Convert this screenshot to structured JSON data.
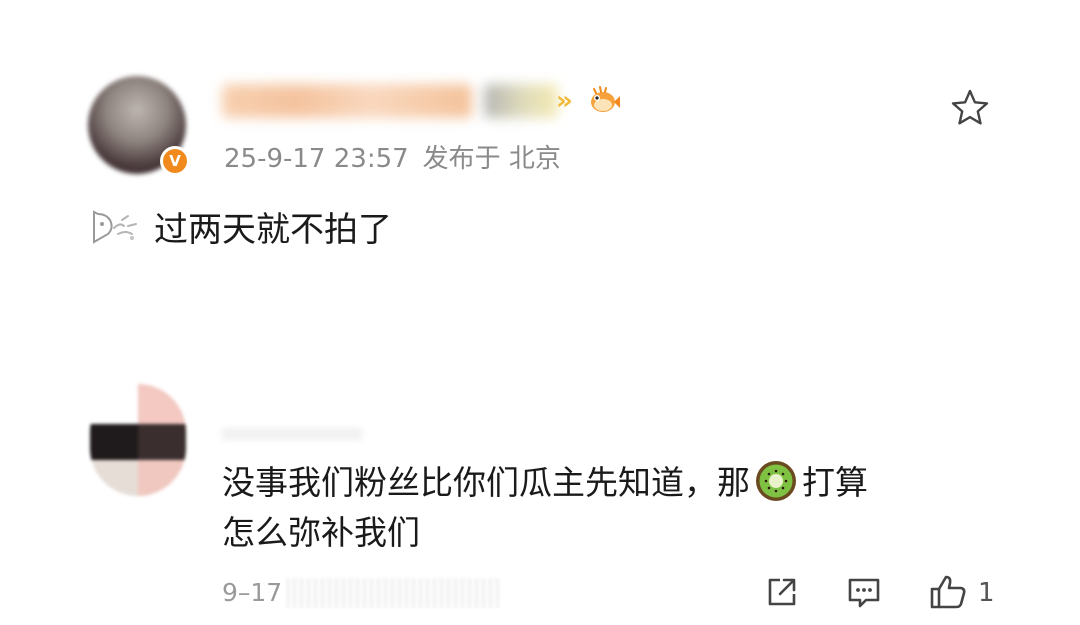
{
  "post": {
    "timestamp": "25-9-17 23:57",
    "location_label": "发布于 北京",
    "text": "过两天就不拍了",
    "verified_badge": "V",
    "icons": [
      "verified-badge-icon",
      "pufferfish-icon",
      "star-icon",
      "emote-icon"
    ]
  },
  "reply": {
    "line1_before": "没事我们粉丝比你们瓜主先知道，那",
    "line1_after": "打算",
    "line2": "怎么弥补我们",
    "date": "9–17",
    "like_count": "1",
    "icons": [
      "kiwi-emoji-icon",
      "share-icon",
      "comment-icon",
      "like-icon"
    ]
  },
  "colors": {
    "badge": "#f08a1c",
    "meta_text": "#8a8a8a",
    "body_text": "#1a1a1a",
    "icon_stroke": "#444444"
  }
}
